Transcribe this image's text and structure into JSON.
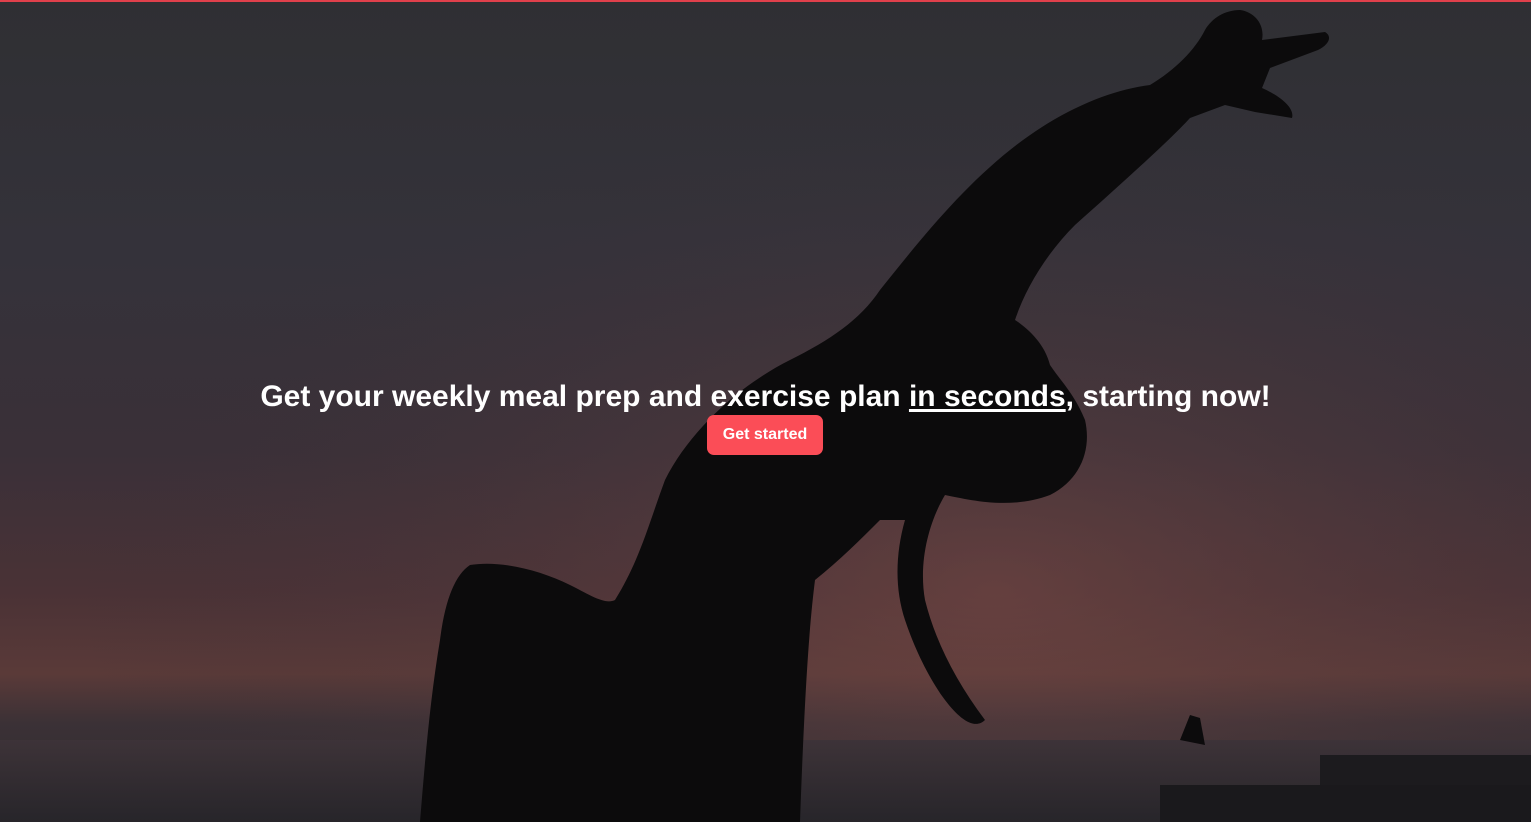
{
  "hero": {
    "headline_before": "Get your weekly meal prep and exercise plan ",
    "headline_emphasis": "in seconds",
    "headline_after": ", starting now!",
    "cta_label": "Get started"
  },
  "colors": {
    "accent": "#fb4d57",
    "top_border": "#e0404b",
    "text": "#ffffff"
  }
}
